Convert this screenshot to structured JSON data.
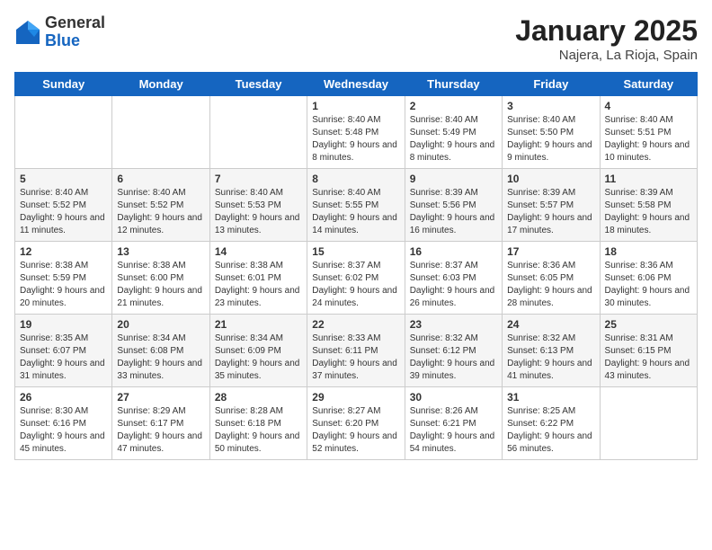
{
  "logo": {
    "general": "General",
    "blue": "Blue"
  },
  "title": {
    "month": "January 2025",
    "location": "Najera, La Rioja, Spain"
  },
  "weekdays": [
    "Sunday",
    "Monday",
    "Tuesday",
    "Wednesday",
    "Thursday",
    "Friday",
    "Saturday"
  ],
  "weeks": [
    [
      {
        "day": "",
        "info": ""
      },
      {
        "day": "",
        "info": ""
      },
      {
        "day": "",
        "info": ""
      },
      {
        "day": "1",
        "info": "Sunrise: 8:40 AM\nSunset: 5:48 PM\nDaylight: 9 hours and 8 minutes."
      },
      {
        "day": "2",
        "info": "Sunrise: 8:40 AM\nSunset: 5:49 PM\nDaylight: 9 hours and 8 minutes."
      },
      {
        "day": "3",
        "info": "Sunrise: 8:40 AM\nSunset: 5:50 PM\nDaylight: 9 hours and 9 minutes."
      },
      {
        "day": "4",
        "info": "Sunrise: 8:40 AM\nSunset: 5:51 PM\nDaylight: 9 hours and 10 minutes."
      }
    ],
    [
      {
        "day": "5",
        "info": "Sunrise: 8:40 AM\nSunset: 5:52 PM\nDaylight: 9 hours and 11 minutes."
      },
      {
        "day": "6",
        "info": "Sunrise: 8:40 AM\nSunset: 5:52 PM\nDaylight: 9 hours and 12 minutes."
      },
      {
        "day": "7",
        "info": "Sunrise: 8:40 AM\nSunset: 5:53 PM\nDaylight: 9 hours and 13 minutes."
      },
      {
        "day": "8",
        "info": "Sunrise: 8:40 AM\nSunset: 5:55 PM\nDaylight: 9 hours and 14 minutes."
      },
      {
        "day": "9",
        "info": "Sunrise: 8:39 AM\nSunset: 5:56 PM\nDaylight: 9 hours and 16 minutes."
      },
      {
        "day": "10",
        "info": "Sunrise: 8:39 AM\nSunset: 5:57 PM\nDaylight: 9 hours and 17 minutes."
      },
      {
        "day": "11",
        "info": "Sunrise: 8:39 AM\nSunset: 5:58 PM\nDaylight: 9 hours and 18 minutes."
      }
    ],
    [
      {
        "day": "12",
        "info": "Sunrise: 8:38 AM\nSunset: 5:59 PM\nDaylight: 9 hours and 20 minutes."
      },
      {
        "day": "13",
        "info": "Sunrise: 8:38 AM\nSunset: 6:00 PM\nDaylight: 9 hours and 21 minutes."
      },
      {
        "day": "14",
        "info": "Sunrise: 8:38 AM\nSunset: 6:01 PM\nDaylight: 9 hours and 23 minutes."
      },
      {
        "day": "15",
        "info": "Sunrise: 8:37 AM\nSunset: 6:02 PM\nDaylight: 9 hours and 24 minutes."
      },
      {
        "day": "16",
        "info": "Sunrise: 8:37 AM\nSunset: 6:03 PM\nDaylight: 9 hours and 26 minutes."
      },
      {
        "day": "17",
        "info": "Sunrise: 8:36 AM\nSunset: 6:05 PM\nDaylight: 9 hours and 28 minutes."
      },
      {
        "day": "18",
        "info": "Sunrise: 8:36 AM\nSunset: 6:06 PM\nDaylight: 9 hours and 30 minutes."
      }
    ],
    [
      {
        "day": "19",
        "info": "Sunrise: 8:35 AM\nSunset: 6:07 PM\nDaylight: 9 hours and 31 minutes."
      },
      {
        "day": "20",
        "info": "Sunrise: 8:34 AM\nSunset: 6:08 PM\nDaylight: 9 hours and 33 minutes."
      },
      {
        "day": "21",
        "info": "Sunrise: 8:34 AM\nSunset: 6:09 PM\nDaylight: 9 hours and 35 minutes."
      },
      {
        "day": "22",
        "info": "Sunrise: 8:33 AM\nSunset: 6:11 PM\nDaylight: 9 hours and 37 minutes."
      },
      {
        "day": "23",
        "info": "Sunrise: 8:32 AM\nSunset: 6:12 PM\nDaylight: 9 hours and 39 minutes."
      },
      {
        "day": "24",
        "info": "Sunrise: 8:32 AM\nSunset: 6:13 PM\nDaylight: 9 hours and 41 minutes."
      },
      {
        "day": "25",
        "info": "Sunrise: 8:31 AM\nSunset: 6:15 PM\nDaylight: 9 hours and 43 minutes."
      }
    ],
    [
      {
        "day": "26",
        "info": "Sunrise: 8:30 AM\nSunset: 6:16 PM\nDaylight: 9 hours and 45 minutes."
      },
      {
        "day": "27",
        "info": "Sunrise: 8:29 AM\nSunset: 6:17 PM\nDaylight: 9 hours and 47 minutes."
      },
      {
        "day": "28",
        "info": "Sunrise: 8:28 AM\nSunset: 6:18 PM\nDaylight: 9 hours and 50 minutes."
      },
      {
        "day": "29",
        "info": "Sunrise: 8:27 AM\nSunset: 6:20 PM\nDaylight: 9 hours and 52 minutes."
      },
      {
        "day": "30",
        "info": "Sunrise: 8:26 AM\nSunset: 6:21 PM\nDaylight: 9 hours and 54 minutes."
      },
      {
        "day": "31",
        "info": "Sunrise: 8:25 AM\nSunset: 6:22 PM\nDaylight: 9 hours and 56 minutes."
      },
      {
        "day": "",
        "info": ""
      }
    ]
  ]
}
